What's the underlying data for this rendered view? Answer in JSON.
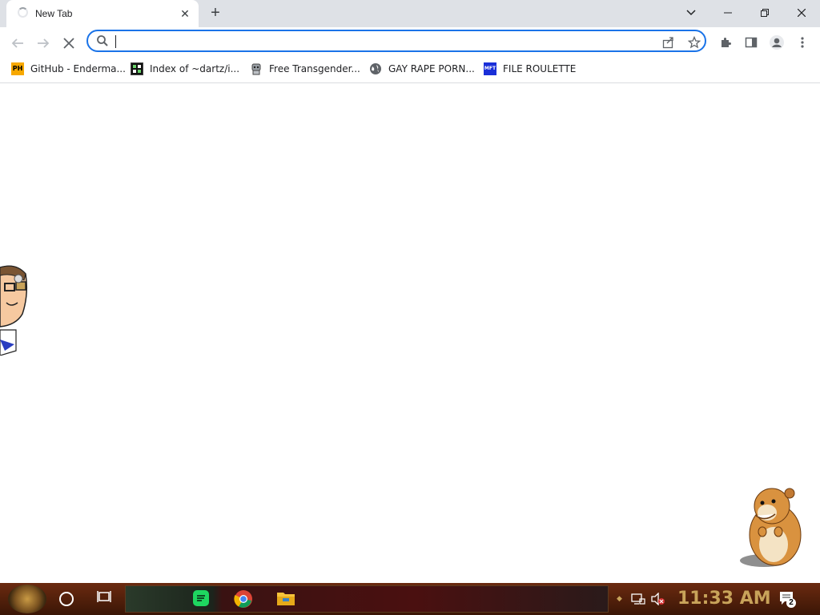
{
  "browser": {
    "tab": {
      "title": "New Tab",
      "close_icon": "close-icon",
      "loading_icon": "spinner-icon"
    },
    "new_tab_icon": "plus-icon",
    "window_controls": [
      "chevron-down-icon",
      "minimize-icon",
      "restore-icon",
      "close-icon"
    ]
  },
  "toolbar": {
    "back_icon": "back-arrow-icon",
    "forward_icon": "forward-arrow-icon",
    "stop_icon": "stop-icon",
    "omnibox_value": "",
    "omnibox_placeholder": "",
    "share_icon": "share-icon",
    "bookmark_icon": "star-icon",
    "extensions_icon": "puzzle-icon",
    "sidepanel_icon": "side-panel-icon",
    "profile_icon": "profile-icon",
    "menu_icon": "kebab-menu-icon"
  },
  "bookmarks": [
    {
      "label": "GitHub - Enderma...",
      "icon": "ph-favicon",
      "favicon_text": "PH"
    },
    {
      "label": "Index of ~dartz/i...",
      "icon": "grid-favicon",
      "favicon_text": ""
    },
    {
      "label": "Free Transgender...",
      "icon": "robot-favicon",
      "favicon_text": ""
    },
    {
      "label": "GAY RAPE PORN...",
      "icon": "globe-icon",
      "favicon_text": ""
    },
    {
      "label": "FILE ROULETTE",
      "icon": "mft-favicon",
      "favicon_text": "MFT"
    }
  ],
  "taskbar": {
    "start_icon": "start-orb-icon",
    "cortana_icon": "cortana-icon",
    "taskview_icon": "task-view-icon",
    "apps": [
      "spotify-icon",
      "chrome-icon",
      "file-explorer-icon"
    ],
    "tray_icons": [
      "network-icon",
      "volume-muted-icon"
    ],
    "clock": "11:33 AM",
    "notifications_count": "2"
  },
  "colors": {
    "accent": "#1a73e8",
    "tabstrip": "#dee1e6",
    "clock": "#c8a35a"
  }
}
